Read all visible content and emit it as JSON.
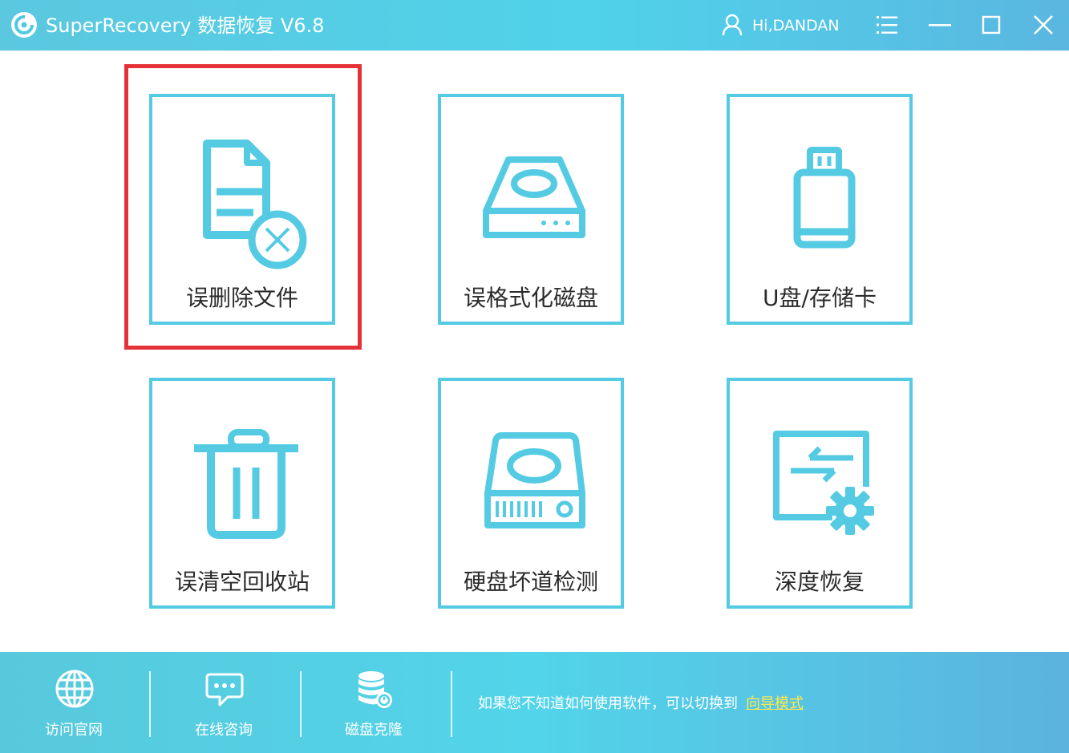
{
  "app": {
    "title": "SuperRecovery 数据恢复 V6.8",
    "user": "Hi,DANDAN"
  },
  "tiles": [
    {
      "label": "误删除文件",
      "icon": "deleted-file-icon",
      "selected": true
    },
    {
      "label": "误格式化磁盘",
      "icon": "format-disk-icon"
    },
    {
      "label": "U盘/存储卡",
      "icon": "usb-drive-icon"
    },
    {
      "label": "误清空回收站",
      "icon": "recycle-bin-icon"
    },
    {
      "label": "硬盘坏道检测",
      "icon": "hard-disk-check-icon"
    },
    {
      "label": "深度恢复",
      "icon": "deep-recovery-icon"
    }
  ],
  "footer": {
    "items": [
      {
        "label": "访问官网",
        "icon": "globe-icon"
      },
      {
        "label": "在线咨询",
        "icon": "chat-icon"
      },
      {
        "label": "磁盘克隆",
        "icon": "disk-clone-icon"
      }
    ],
    "hint": "如果您不知道如何使用软件，可以切换到",
    "guide_link": "向导模式"
  },
  "colors": {
    "accent": "#54cbe3",
    "highlight": "#e53238",
    "link": "#ffe94a"
  }
}
